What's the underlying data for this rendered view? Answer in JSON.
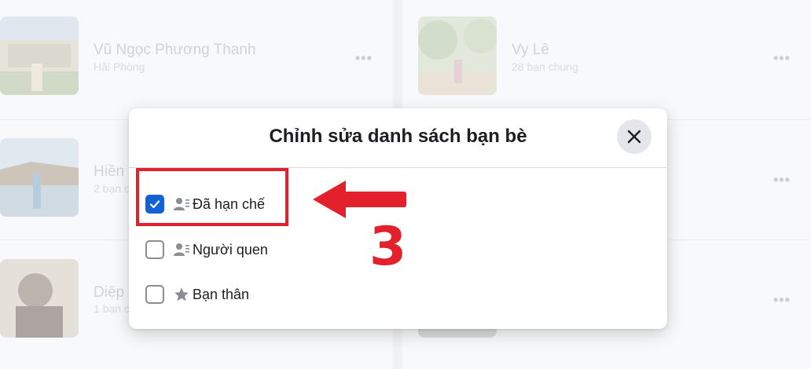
{
  "friends": [
    {
      "name": "Vũ Ngọc Phương Thanh",
      "sub": "Hải Phòng"
    },
    {
      "name": "Vy Lê",
      "sub": "28 bạn chung"
    },
    {
      "name": "Hiền",
      "sub": "2 bạn c"
    },
    {
      "name": "Diệp",
      "sub": "1 bạn c"
    }
  ],
  "more_label": "•••",
  "dialog": {
    "title": "Chỉnh sửa danh sách bạn bè",
    "options": [
      {
        "label": "Đã hạn chế",
        "checked": true,
        "icon": "restricted-person-icon"
      },
      {
        "label": "Người quen",
        "checked": false,
        "icon": "acquaintance-person-icon"
      },
      {
        "label": "Bạn thân",
        "checked": false,
        "icon": "star-icon"
      }
    ]
  },
  "annotation": {
    "step": "3"
  },
  "colors": {
    "accent": "#1361d6",
    "annotation_red": "#e3212d"
  }
}
